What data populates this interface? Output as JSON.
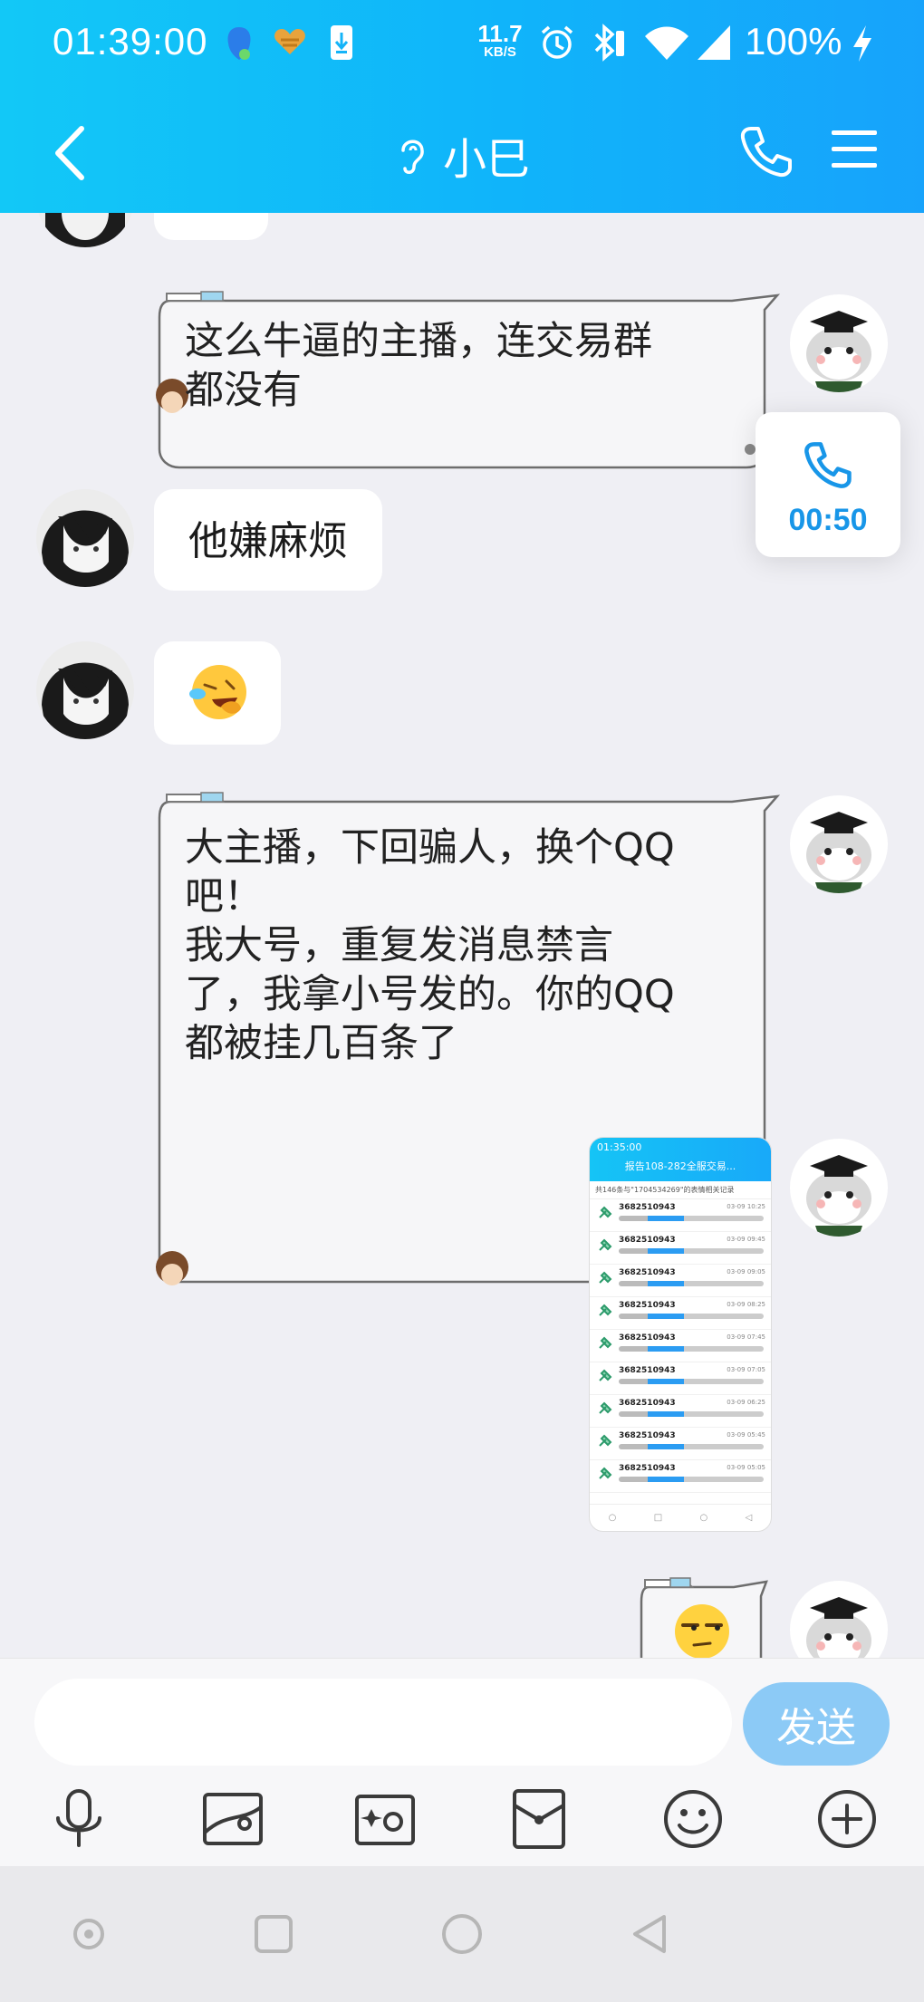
{
  "status_bar": {
    "time": "01:39:00",
    "net_speed_value": "11.7",
    "net_speed_unit": "KB/S",
    "battery": "100%"
  },
  "nav": {
    "title": "小巳",
    "icons": [
      "back-icon",
      "earpiece-icon",
      "phone-icon",
      "menu-icon"
    ]
  },
  "call_overlay": {
    "duration": "00:50"
  },
  "messages": [
    {
      "side": "right",
      "style": "theme",
      "text": "这么牛逼的主播，连交易群\n都没有"
    },
    {
      "side": "left",
      "style": "plain",
      "text": "他嫌麻烦"
    },
    {
      "side": "left",
      "style": "emoji",
      "emoji": "😆"
    },
    {
      "side": "right",
      "style": "theme",
      "text": "大主播，下回骗人，换个QQ\n吧！\n我大号，重复发消息禁言\n了，我拿小号发的。你的QQ\n都被挂几百条了"
    },
    {
      "side": "right",
      "style": "image"
    },
    {
      "side": "right",
      "style": "theme-emoji",
      "emoji": "😒"
    }
  ],
  "screenshot_thumb": {
    "status_time": "01:35:00",
    "title": "报告108-282全服交易...",
    "subtitle": "共146条与\"1704534269\"的表情相关记录",
    "rows": [
      {
        "id": "3682510943",
        "date": "03-09 10:25"
      },
      {
        "id": "3682510943",
        "date": "03-09 09:45"
      },
      {
        "id": "3682510943",
        "date": "03-09 09:05"
      },
      {
        "id": "3682510943",
        "date": "03-09 08:25"
      },
      {
        "id": "3682510943",
        "date": "03-09 07:45"
      },
      {
        "id": "3682510943",
        "date": "03-09 07:05"
      },
      {
        "id": "3682510943",
        "date": "03-09 06:25"
      },
      {
        "id": "3682510943",
        "date": "03-09 05:45"
      },
      {
        "id": "3682510943",
        "date": "03-09 05:05"
      }
    ]
  },
  "input": {
    "value": "",
    "send_label": "发送"
  },
  "toolbar": [
    "mic-icon",
    "image-icon",
    "camera-icon",
    "red-packet-icon",
    "emoji-icon",
    "plus-icon"
  ],
  "colors": {
    "header_start": "#12c8f7",
    "header_end": "#17a3fb",
    "chat_bg": "#efeff4",
    "send_button": "#8ccaf6",
    "call_time": "#1896e8"
  }
}
